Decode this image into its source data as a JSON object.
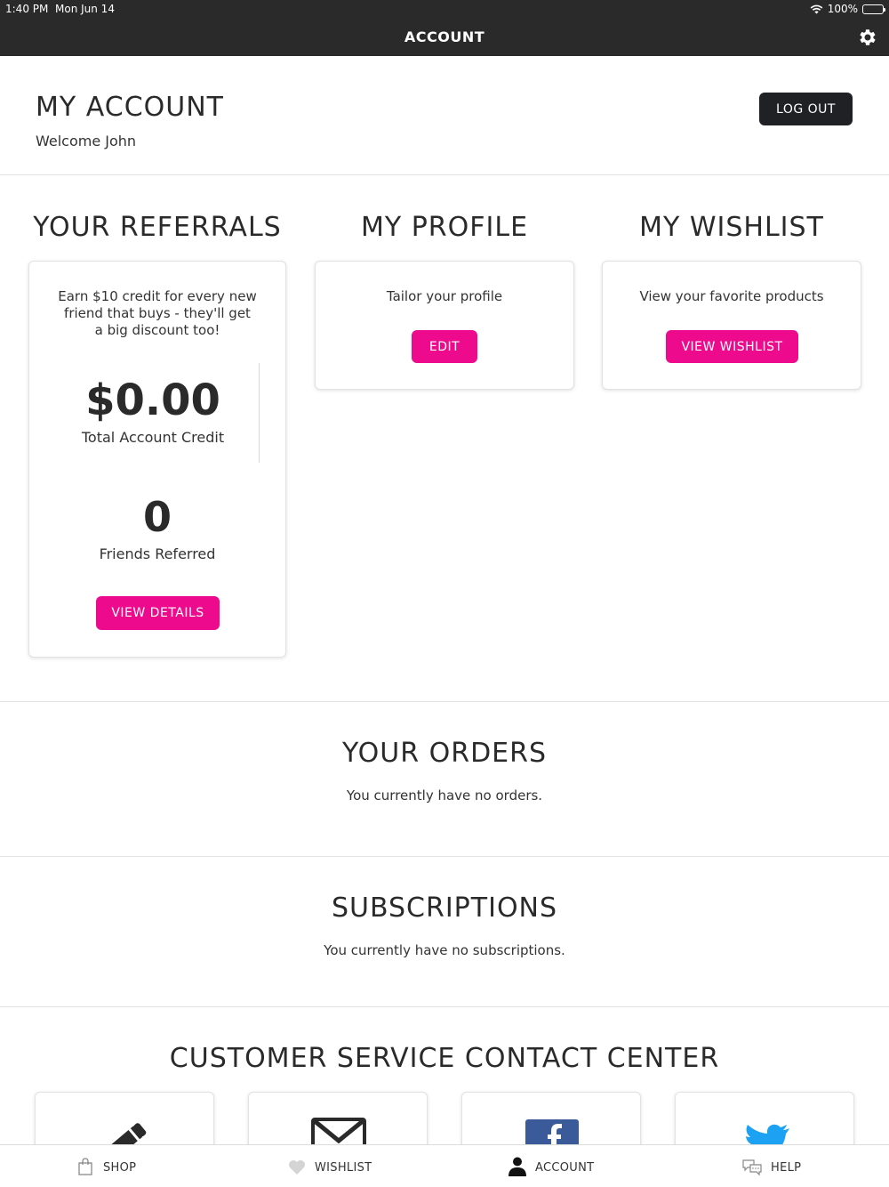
{
  "status": {
    "time": "1:40 PM",
    "date": "Mon Jun 14",
    "battery": "100%"
  },
  "nav": {
    "title": "ACCOUNT"
  },
  "account": {
    "title": "MY ACCOUNT",
    "welcome": "Welcome John",
    "logout_label": "LOG OUT"
  },
  "referrals": {
    "title": "YOUR REFERRALS",
    "text_lines": [
      "Earn $10 credit for every new",
      "friend that buys - they'll get",
      "a big discount too!"
    ],
    "credit_value": "$0.00",
    "credit_label": "Total Account Credit",
    "friends_value": "0",
    "friends_label": "Friends Referred",
    "button_label": "VIEW DETAILS"
  },
  "profile": {
    "title": "MY PROFILE",
    "text": "Tailor your profile",
    "button_label": "EDIT"
  },
  "wishlist": {
    "title": "MY WISHLIST",
    "text": "View your favorite products",
    "button_label": "VIEW WISHLIST"
  },
  "orders": {
    "title": "YOUR ORDERS",
    "text": "You currently have no orders."
  },
  "subscriptions": {
    "title": "SUBSCRIPTIONS",
    "text": "You currently have no subscriptions."
  },
  "customer_service": {
    "title": "CUSTOMER SERVICE CONTACT CENTER",
    "cards": [
      {
        "icon": "pencil-icon"
      },
      {
        "icon": "envelope-icon"
      },
      {
        "icon": "facebook-icon"
      },
      {
        "icon": "twitter-icon"
      }
    ]
  },
  "tabs": [
    {
      "label": "SHOP",
      "icon": "shopping-bag-icon"
    },
    {
      "label": "WISHLIST",
      "icon": "heart-icon"
    },
    {
      "label": "ACCOUNT",
      "icon": "person-icon"
    },
    {
      "label": "HELP",
      "icon": "chat-bubbles-icon"
    }
  ],
  "colors": {
    "accent": "#ee0a8c",
    "header": "#2a2a2a",
    "logout": "#1f2124"
  }
}
